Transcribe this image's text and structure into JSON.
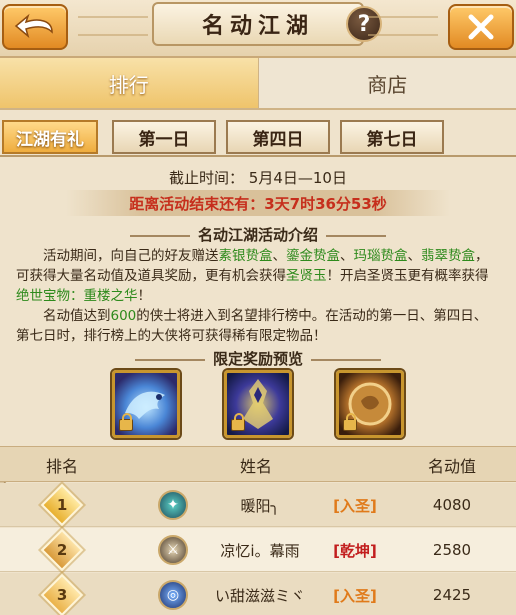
{
  "header": {
    "title": "名动江湖",
    "help_label": "?"
  },
  "main_tabs": [
    {
      "label": "排行"
    },
    {
      "label": "商店"
    }
  ],
  "sub_tabs": [
    {
      "label": "江湖有礼"
    },
    {
      "label": "第一日"
    },
    {
      "label": "第四日"
    },
    {
      "label": "第七日"
    }
  ],
  "event": {
    "deadline": "截止时间：  5月4日—10日",
    "countdown": "距离活动结束还有：3天7时36分53秒",
    "intro_title": "名动江湖活动介绍",
    "desc": {
      "p1_a": "活动期间，向自己的好友赠送",
      "gift1": "素银贽盒",
      "sep1": "、",
      "gift2": "鎏金贽盒",
      "sep2": "、",
      "gift3": "玛瑙贽盒",
      "sep3": "、",
      "gift4": "翡翠贽盒",
      "p1_b": "，可获得大量名动值及道具奖励，更有机会获得",
      "item1": "圣贤玉",
      "p1_c": "！开启圣贤玉更有概率获得",
      "item2": "绝世宝物：重楼之华",
      "p1_d": "！",
      "p2_a": "名动值达到",
      "threshold": "600",
      "p2_b": "的侠士将进入到名望排行榜中。在活动的第一日、第四日、第七日时，排行榜上的大侠将可获得稀有限定物品！"
    }
  },
  "rewards": {
    "title": "限定奖励预览",
    "items": [
      {
        "icon": "blue-dragon-icon"
      },
      {
        "icon": "armored-warrior-icon"
      },
      {
        "icon": "jade-orb-icon"
      }
    ]
  },
  "table": {
    "headers": [
      "排名",
      "姓名",
      "名动值"
    ],
    "rows": [
      {
        "rank": "1",
        "name": "暖阳╮",
        "faction": "[入圣]",
        "faction_color": "#e07a1a",
        "value": "4080"
      },
      {
        "rank": "2",
        "name": "凉忆i。幕雨",
        "faction": "[乾坤]",
        "faction_color": "#c21e1e",
        "value": "2580"
      },
      {
        "rank": "3",
        "name": "い甜滋滋ミヾ",
        "faction": "[入圣]",
        "faction_color": "#e07a1a",
        "value": "2425"
      }
    ]
  },
  "colors": {
    "accent_orange": "#efad3e",
    "countdown_red": "#c62e1c",
    "highlight_green": "#2e8a1c"
  }
}
